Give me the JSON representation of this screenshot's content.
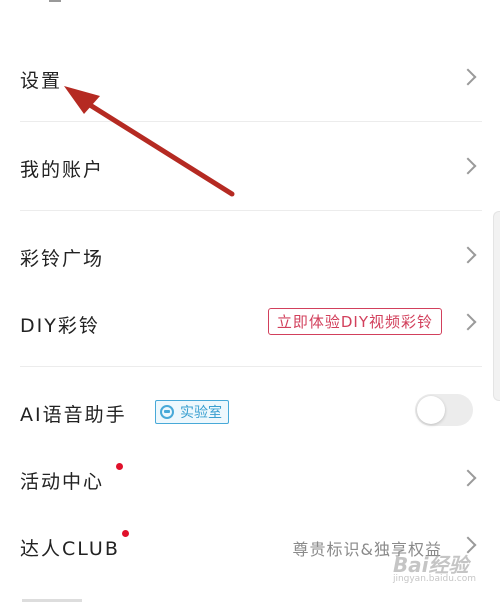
{
  "menu": {
    "settings": "设置",
    "my_account": "我的账户",
    "ringtone_square": "彩铃广场",
    "diy_ringtone": "DIY彩铃",
    "diy_promo": "立即体验DIY视频彩铃",
    "ai_assistant": "AI语音助手",
    "lab_badge": "实验室",
    "activity_center": "活动中心",
    "expert_club": "达人CLUB",
    "expert_club_hint": "尊贵标识&独享权益"
  },
  "toggles": {
    "ai_assistant_on": false
  },
  "annotation": {
    "arrow_color": "#b52a22"
  },
  "watermark": {
    "logo": "Bai经验",
    "url": "jingyan.baidu.com"
  },
  "colors": {
    "promo": "#d2405c",
    "lab": "#48a9d8",
    "dot": "#e0112b"
  }
}
